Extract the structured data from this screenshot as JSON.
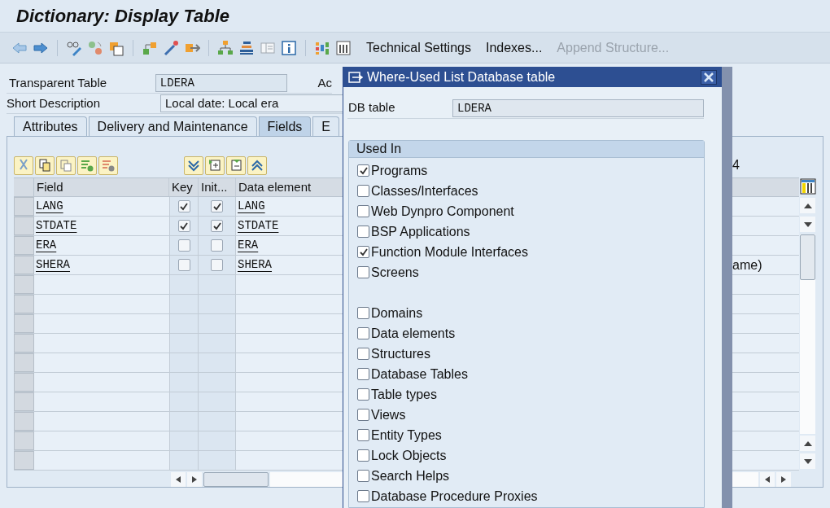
{
  "title": "Dictionary: Display Table",
  "toolbar": {
    "buttons": [
      {
        "label": "Technical Settings",
        "disabled": false
      },
      {
        "label": "Indexes...",
        "disabled": false
      },
      {
        "label": "Append Structure...",
        "disabled": true
      }
    ]
  },
  "header": {
    "transparent_table": {
      "label": "Transparent Table",
      "value": "LDERA"
    },
    "short_description": {
      "label": "Short Description",
      "value": "Local date: Local era"
    },
    "column_3_label": "Ac"
  },
  "tabs": [
    {
      "label": "Attributes",
      "selected": false
    },
    {
      "label": "Delivery and Maintenance",
      "selected": false
    },
    {
      "label": "Fields",
      "selected": true
    },
    {
      "label": "E",
      "selected": false
    }
  ],
  "fields_table": {
    "counter": "4",
    "columns": [
      "Field",
      "Key",
      "Init...",
      "Data element"
    ],
    "rows": [
      {
        "field": "LANG",
        "key": true,
        "initial": true,
        "data_element": "LANG"
      },
      {
        "field": "STDATE",
        "key": true,
        "initial": true,
        "data_element": "STDATE"
      },
      {
        "field": "ERA",
        "key": false,
        "initial": false,
        "data_element": "ERA"
      },
      {
        "field": "SHERA",
        "key": false,
        "initial": false,
        "data_element": "SHERA",
        "column_5": "ame)"
      }
    ]
  },
  "dialog": {
    "title": "Where-Used List Database table",
    "db_table": {
      "label": "DB table",
      "value": "LDERA"
    },
    "group_title": "Used In",
    "groups": [
      {
        "items": [
          {
            "label": "Programs",
            "checked": true
          },
          {
            "label": "Classes/Interfaces",
            "checked": false
          },
          {
            "label": "Web Dynpro Component",
            "checked": false
          },
          {
            "label": "BSP Applications",
            "checked": false
          },
          {
            "label": "Function Module Interfaces",
            "checked": true
          },
          {
            "label": "Screens",
            "checked": false
          }
        ]
      },
      {
        "items": [
          {
            "label": "Domains",
            "checked": false
          },
          {
            "label": "Data elements",
            "checked": false
          },
          {
            "label": "Structures",
            "checked": false
          },
          {
            "label": "Database Tables",
            "checked": false
          },
          {
            "label": "Table types",
            "checked": false
          },
          {
            "label": "Views",
            "checked": false
          },
          {
            "label": "Entity Types",
            "checked": false
          },
          {
            "label": "Lock Objects",
            "checked": false
          },
          {
            "label": "Search Helps",
            "checked": false
          },
          {
            "label": "Database Procedure Proxies",
            "checked": false
          }
        ]
      }
    ]
  }
}
